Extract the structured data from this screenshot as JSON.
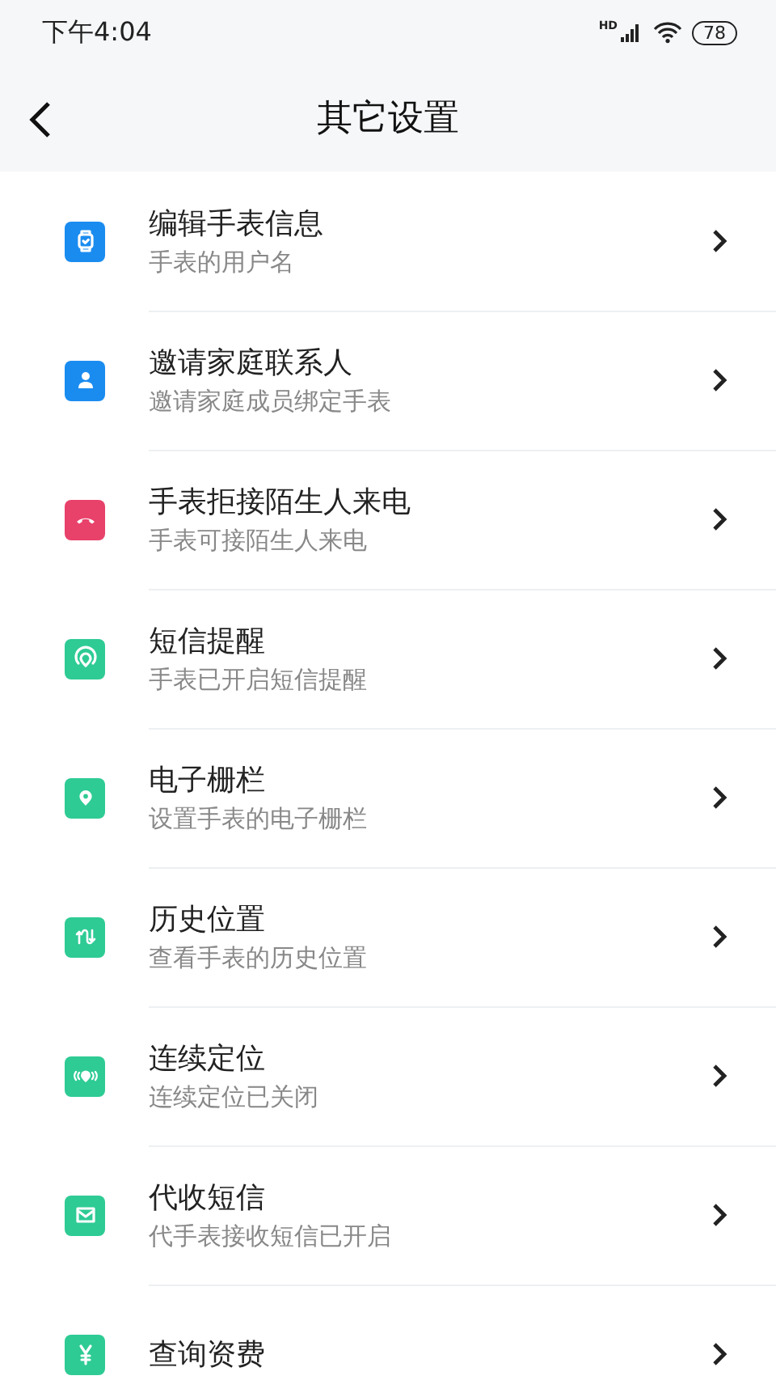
{
  "status_bar": {
    "time": "下午4:04",
    "network": "HD",
    "battery": "78"
  },
  "header": {
    "title": "其它设置"
  },
  "items": [
    {
      "title": "编辑手表信息",
      "subtitle": "手表的用户名",
      "color": "#1a8cf0"
    },
    {
      "title": "邀请家庭联系人",
      "subtitle": "邀请家庭成员绑定手表",
      "color": "#1a8cf0"
    },
    {
      "title": "手表拒接陌生人来电",
      "subtitle": "手表可接陌生人来电",
      "color": "#e8416a"
    },
    {
      "title": "短信提醒",
      "subtitle": "手表已开启短信提醒",
      "color": "#2ecb94"
    },
    {
      "title": "电子栅栏",
      "subtitle": "设置手表的电子栅栏",
      "color": "#2ecb94"
    },
    {
      "title": "历史位置",
      "subtitle": "查看手表的历史位置",
      "color": "#2ecb94"
    },
    {
      "title": "连续定位",
      "subtitle": "连续定位已关闭",
      "color": "#2ecb94"
    },
    {
      "title": "代收短信",
      "subtitle": "代手表接收短信已开启",
      "color": "#2ecb94"
    },
    {
      "title": "查询资费",
      "color": "#2ecb94"
    }
  ]
}
